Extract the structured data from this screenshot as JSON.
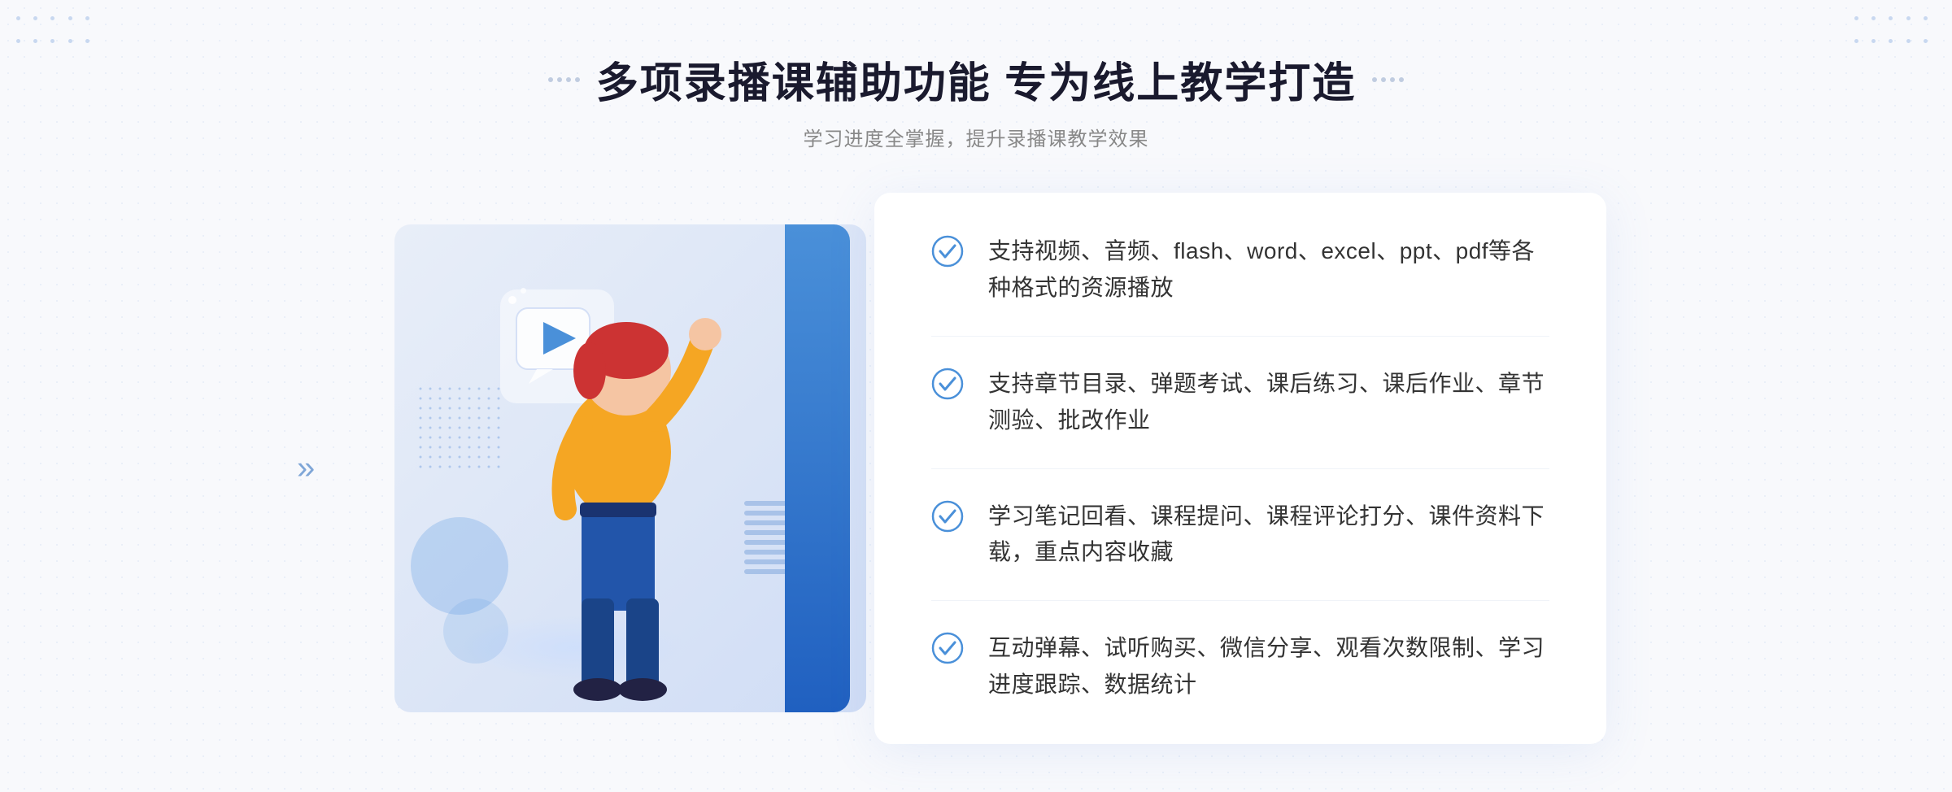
{
  "header": {
    "title": "多项录播课辅助功能 专为线上教学打造",
    "subtitle": "学习进度全掌握，提升录播课教学效果"
  },
  "features": [
    {
      "id": 1,
      "text": "支持视频、音频、flash、word、excel、ppt、pdf等各种格式的资源播放"
    },
    {
      "id": 2,
      "text": "支持章节目录、弹题考试、课后练习、课后作业、章节测验、批改作业"
    },
    {
      "id": 3,
      "text": "学习笔记回看、课程提问、课程评论打分、课件资料下载，重点内容收藏"
    },
    {
      "id": 4,
      "text": "互动弹幕、试听购买、微信分享、观看次数限制、学习进度跟踪、数据统计"
    }
  ],
  "decorations": {
    "chevron": "»",
    "play_label": "play"
  }
}
